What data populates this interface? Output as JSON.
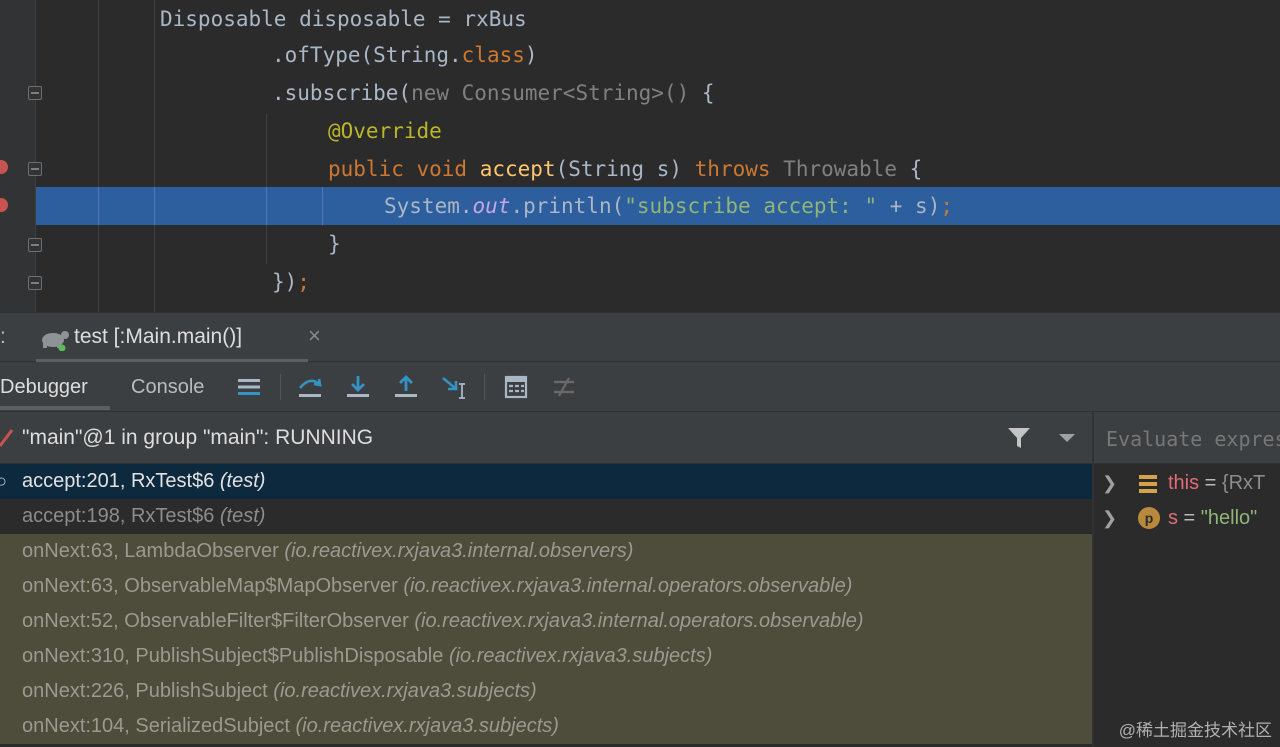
{
  "editor": {
    "lines": [
      {
        "segments": [
          {
            "t": "Disposable disposable = rxBus",
            "c": "plain"
          }
        ]
      },
      {
        "segments": [
          {
            "t": ".ofType(String.",
            "c": "plain"
          },
          {
            "t": "class",
            "c": "kw"
          },
          {
            "t": ")",
            "c": "plain"
          }
        ]
      },
      {
        "segments": [
          {
            "t": ".subscribe(",
            "c": "plain"
          },
          {
            "t": "new Consumer<String>() ",
            "c": "dim"
          },
          {
            "t": "{",
            "c": "plain"
          }
        ]
      },
      {
        "segments": [
          {
            "t": "@Override",
            "c": "ann"
          }
        ]
      },
      {
        "segments": [
          {
            "t": "public void ",
            "c": "kw"
          },
          {
            "t": "accept",
            "c": "fn"
          },
          {
            "t": "(String s) ",
            "c": "plain"
          },
          {
            "t": "throws ",
            "c": "kw"
          },
          {
            "t": "Throwable ",
            "c": "dim"
          },
          {
            "t": "{",
            "c": "plain"
          }
        ]
      },
      {
        "segments": [
          {
            "t": "System.",
            "c": "plain"
          },
          {
            "t": "out",
            "c": "fld"
          },
          {
            "t": ".println(",
            "c": "plain"
          },
          {
            "t": "\"subscribe accept: \"",
            "c": "str"
          },
          {
            "t": " + s)",
            "c": "plain"
          },
          {
            "t": ";",
            "c": "kw"
          }
        ]
      },
      {
        "segments": [
          {
            "t": "}",
            "c": "plain"
          }
        ]
      },
      {
        "segments": [
          {
            "t": "})",
            "c": "plain"
          },
          {
            "t": ";",
            "c": "kw"
          }
        ]
      }
    ]
  },
  "run_tab": {
    "prefix": ":",
    "label": "test [:Main.main()]",
    "close": "×",
    "icon": "run-config-icon"
  },
  "debugger": {
    "tabs": {
      "debugger": "Debugger",
      "console": "Console"
    },
    "toolbar_icons": [
      "threads-menu-icon",
      "step-over-icon",
      "step-into-icon",
      "step-out-icon",
      "run-to-cursor-icon",
      "evaluate-expression-icon",
      "trace-current-stream-icon"
    ]
  },
  "frames": {
    "thread": "\"main\"@1 in group \"main\": RUNNING",
    "items": [
      {
        "loc": "accept:201, RxTest$6",
        "pkg": "(test)",
        "style": "selected"
      },
      {
        "loc": "accept:198, RxTest$6",
        "pkg": "(test)",
        "style": "normal"
      },
      {
        "loc": "onNext:63, LambdaObserver",
        "pkg": "(io.reactivex.rxjava3.internal.observers)",
        "style": "lib"
      },
      {
        "loc": "onNext:63, ObservableMap$MapObserver",
        "pkg": "(io.reactivex.rxjava3.internal.operators.observable)",
        "style": "lib"
      },
      {
        "loc": "onNext:52, ObservableFilter$FilterObserver",
        "pkg": "(io.reactivex.rxjava3.internal.operators.observable)",
        "style": "lib"
      },
      {
        "loc": "onNext:310, PublishSubject$PublishDisposable",
        "pkg": "(io.reactivex.rxjava3.subjects)",
        "style": "lib"
      },
      {
        "loc": "onNext:226, PublishSubject",
        "pkg": "(io.reactivex.rxjava3.subjects)",
        "style": "lib"
      },
      {
        "loc": "onNext:104, SerializedSubject",
        "pkg": "(io.reactivex.rxjava3.subjects)",
        "style": "lib"
      }
    ]
  },
  "variables": {
    "eval_placeholder": "Evaluate expression",
    "items": [
      {
        "name": "this",
        "eq": " = ",
        "value": "{RxT",
        "kind": "obj"
      },
      {
        "name": "s",
        "eq": " = ",
        "value": "\"hello\"",
        "kind": "str",
        "badge": "p"
      }
    ]
  },
  "watermark": "@稀土掘金技术社区",
  "colors": {
    "exec_line": "#2d5e9e",
    "selected_frame": "#0d293e",
    "library_frame": "#4e4c3b",
    "accent_icon": "#3592c4"
  }
}
